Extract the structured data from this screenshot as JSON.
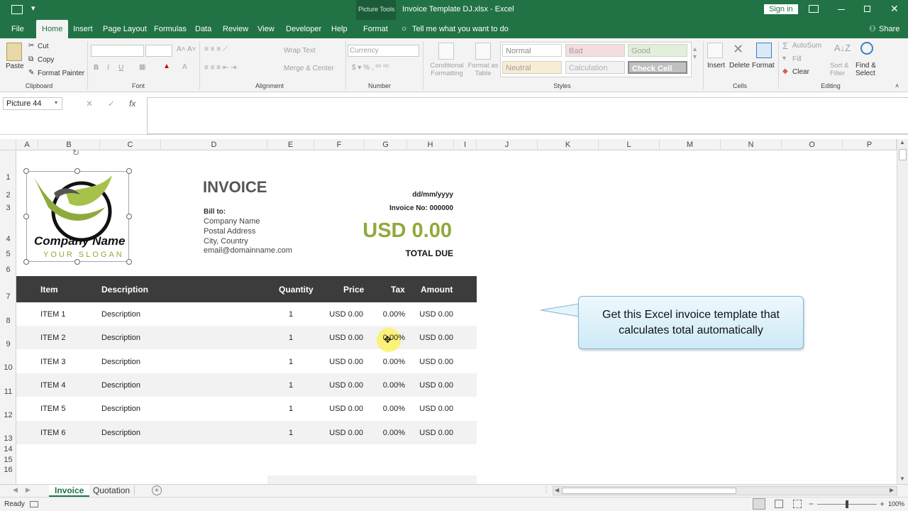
{
  "window": {
    "context_tab": "Picture Tools",
    "title": "Invoice Template DJ.xlsx  -  Excel",
    "sign_in": "Sign in"
  },
  "menu": {
    "tabs": [
      "File",
      "Home",
      "Insert",
      "Page Layout",
      "Formulas",
      "Data",
      "Review",
      "View",
      "Developer",
      "Help",
      "Format"
    ],
    "active": "Home",
    "tell_me": "Tell me what you want to do",
    "share": "Share"
  },
  "ribbon": {
    "clipboard": {
      "paste": "Paste",
      "cut": "Cut",
      "copy": "Copy",
      "format_painter": "Format Painter",
      "label": "Clipboard"
    },
    "font": {
      "bold": "B",
      "italic": "I",
      "underline": "U",
      "label": "Font"
    },
    "alignment": {
      "wrap": "Wrap Text",
      "merge": "Merge & Center",
      "label": "Alignment"
    },
    "number": {
      "format": "Currency",
      "label": "Number"
    },
    "styles": {
      "conditional": "Conditional Formatting",
      "format_table": "Format as Table",
      "normal": "Normal",
      "bad": "Bad",
      "good": "Good",
      "neutral": "Neutral",
      "calculation": "Calculation",
      "check_cell": "Check Cell",
      "label": "Styles"
    },
    "cells": {
      "insert": "Insert",
      "delete": "Delete",
      "format": "Format",
      "label": "Cells"
    },
    "editing": {
      "autosum": "AutoSum",
      "fill": "Fill",
      "clear": "Clear",
      "sort": "Sort & Filter",
      "find": "Find & Select",
      "label": "Editing"
    }
  },
  "formula_bar": {
    "name_box": "Picture 44",
    "fx": "fx",
    "value": ""
  },
  "columns": [
    "A",
    "B",
    "C",
    "D",
    "E",
    "F",
    "G",
    "H",
    "I",
    "J",
    "K",
    "L",
    "M",
    "N",
    "O",
    "P"
  ],
  "rows": [
    "1",
    "2",
    "3",
    "4",
    "5",
    "6",
    "7",
    "8",
    "9",
    "10",
    "11",
    "12",
    "13",
    "14",
    "15",
    "16"
  ],
  "logo": {
    "company": "Company Name",
    "slogan": "YOUR SLOGAN"
  },
  "invoice": {
    "title": "INVOICE",
    "bill_to": "Bill to:",
    "company": "Company Name",
    "address": "Postal Address",
    "city": "City, Country",
    "email": "email@domainname.com",
    "date": "dd/mm/yyyy",
    "invoice_no": "Invoice No: 000000",
    "total": "USD 0.00",
    "total_due": "TOTAL DUE",
    "headers": {
      "item": "Item",
      "description": "Description",
      "quantity": "Quantity",
      "price": "Price",
      "tax": "Tax",
      "amount": "Amount"
    },
    "items": [
      {
        "item": "ITEM 1",
        "description": "Description",
        "quantity": "1",
        "price": "USD 0.00",
        "tax": "0.00%",
        "amount": "USD 0.00"
      },
      {
        "item": "ITEM 2",
        "description": "Description",
        "quantity": "1",
        "price": "USD 0.00",
        "tax": "0.00%",
        "amount": "USD 0.00"
      },
      {
        "item": "ITEM 3",
        "description": "Description",
        "quantity": "1",
        "price": "USD 0.00",
        "tax": "0.00%",
        "amount": "USD 0.00"
      },
      {
        "item": "ITEM 4",
        "description": "Description",
        "quantity": "1",
        "price": "USD 0.00",
        "tax": "0.00%",
        "amount": "USD 0.00"
      },
      {
        "item": "ITEM 5",
        "description": "Description",
        "quantity": "1",
        "price": "USD 0.00",
        "tax": "0.00%",
        "amount": "USD 0.00"
      },
      {
        "item": "ITEM 6",
        "description": "Description",
        "quantity": "1",
        "price": "USD 0.00",
        "tax": "0.00%",
        "amount": "USD 0.00"
      }
    ]
  },
  "callout": {
    "text": "Get this Excel invoice template that calculates total automatically"
  },
  "sheets": {
    "tabs": [
      "Invoice",
      "Quotation"
    ],
    "active": "Invoice"
  },
  "status": {
    "ready": "Ready",
    "zoom": "100%"
  },
  "colors": {
    "excel_green": "#217346",
    "accent": "#8faa3c",
    "table_header": "#3c3c3c"
  }
}
